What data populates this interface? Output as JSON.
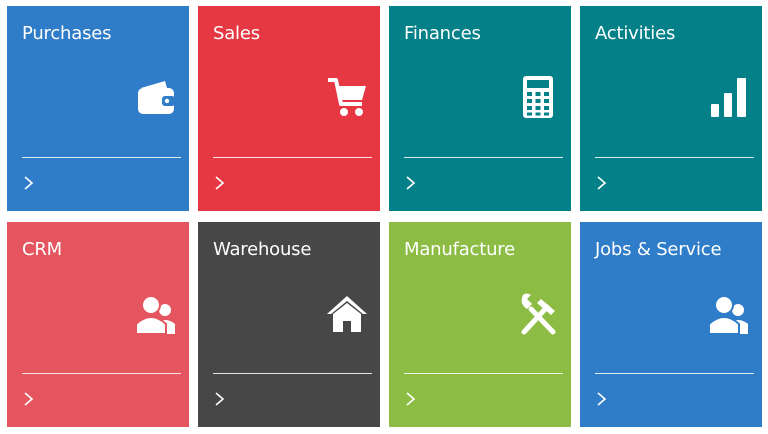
{
  "tiles": [
    {
      "id": "purchases",
      "label": "Purchases",
      "color": "#2f7cc8",
      "icon": "wallet-icon"
    },
    {
      "id": "sales",
      "label": "Sales",
      "color": "#e53843",
      "icon": "shopping-cart-icon"
    },
    {
      "id": "finances",
      "label": "Finances",
      "color": "#048089",
      "icon": "calculator-icon"
    },
    {
      "id": "activities",
      "label": "Activities",
      "color": "#048089",
      "icon": "bar-chart-icon"
    },
    {
      "id": "crm",
      "label": "CRM",
      "color": "#e45560",
      "icon": "users-icon"
    },
    {
      "id": "warehouse",
      "label": "Warehouse",
      "color": "#474747",
      "icon": "home-icon"
    },
    {
      "id": "manufacture",
      "label": "Manufacture",
      "color": "#8cbc44",
      "icon": "tools-icon"
    },
    {
      "id": "jobs-service",
      "label": "Jobs & Service",
      "color": "#2f7cc8",
      "icon": "users-icon"
    }
  ]
}
